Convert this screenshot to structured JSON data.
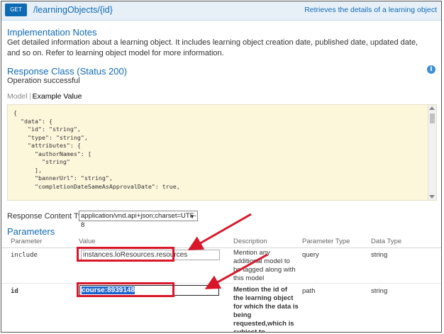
{
  "header": {
    "method": "GET",
    "path": "/learningObjects/{id}",
    "description": "Retrieves the details of a learning object"
  },
  "implementation": {
    "title": "Implementation Notes",
    "text": "Get detailed information about a learning object. It includes learning object creation date, published date, updated date, and so on. Refer to learning object model for more information."
  },
  "response_class": {
    "title": "Response Class (Status 200)",
    "status_text": "Operation successful",
    "tab_model": "Model",
    "tab_example": "Example Value",
    "example_json": "{\n  \"data\": {\n    \"id\": \"string\",\n    \"type\": \"string\",\n    \"attributes\": {\n      \"authorNames\": [\n        \"string\"\n      ],\n      \"bannerUrl\": \"string\",\n      \"completionDateSameAsApprovalDate\": true,"
  },
  "response_content_type": {
    "label": "Response Content Type",
    "selected": "application/vnd.api+json;charset=UTF-8"
  },
  "parameters": {
    "title": "Parameters",
    "columns": [
      "Parameter",
      "Value",
      "Description",
      "Parameter Type",
      "Data Type"
    ],
    "rows": [
      {
        "name": "include",
        "value": "instances.loResources.resources",
        "description": "Mention any additional model to be tagged along with this model",
        "param_type": "query",
        "data_type": "string"
      },
      {
        "name": "id",
        "value": "course:8939148",
        "description": "Mention the id of the learning object for which the data is being requested,which is subject to necessary",
        "param_type": "path",
        "data_type": "string"
      }
    ]
  },
  "colors": {
    "accent": "#0f6ab4",
    "annotation": "#d9172a",
    "json_bg": "#fcf6db"
  }
}
